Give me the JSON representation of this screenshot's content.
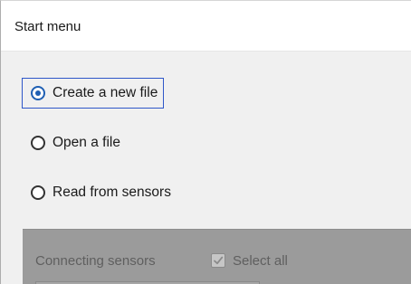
{
  "window": {
    "title": "Start menu"
  },
  "options": [
    {
      "label": "Create a new file",
      "selected": true,
      "focused": true,
      "icon": "radio-checked-icon"
    },
    {
      "label": "Open a file",
      "selected": false,
      "focused": false,
      "icon": "radio-unchecked-icon"
    },
    {
      "label": "Read from sensors",
      "selected": false,
      "focused": false,
      "icon": "radio-unchecked-icon"
    }
  ],
  "sensors_panel": {
    "label": "Connecting sensors",
    "select_all_label": "Select all",
    "select_all_checked": true,
    "enabled": false
  },
  "colors": {
    "accent": "#1f5fb3",
    "focus_outline": "#2e57c9",
    "disabled_panel": "#9b9b9b"
  }
}
